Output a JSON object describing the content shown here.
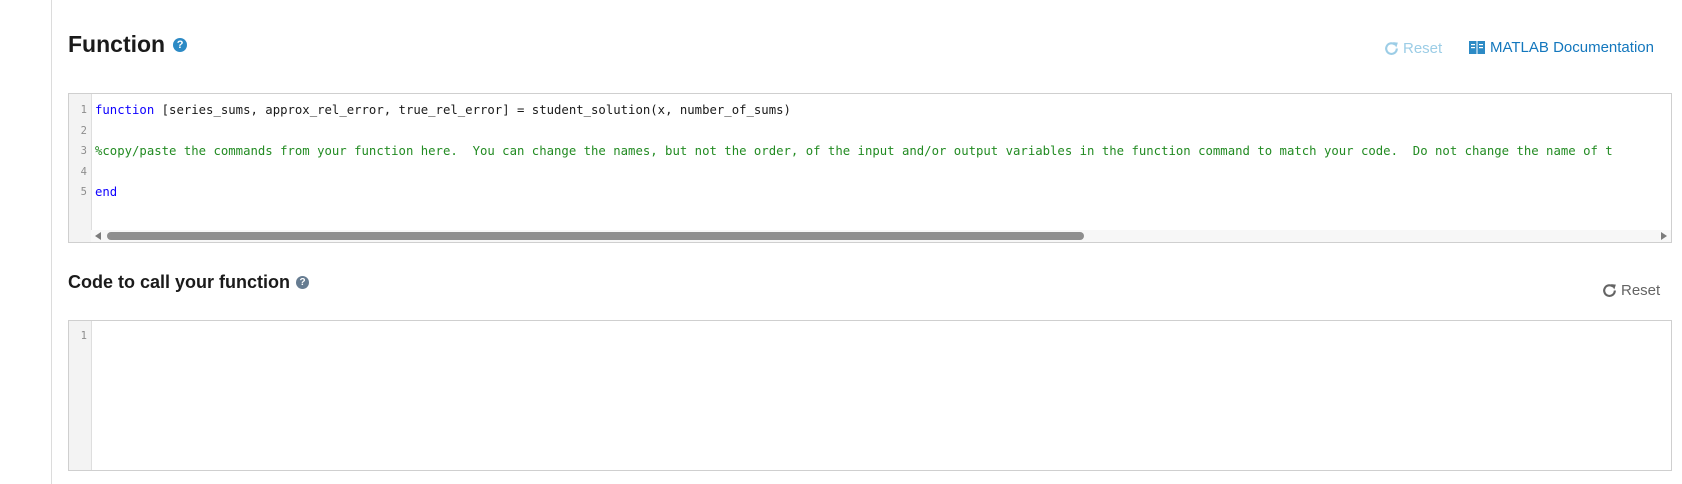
{
  "function_section": {
    "title": "Function",
    "help_icon": "question-circle-icon",
    "reset_label": "Reset",
    "reset_icon": "refresh-icon",
    "doc_label": "MATLAB Documentation",
    "doc_icon": "book-icon",
    "editor": {
      "lines": [
        {
          "num": "1",
          "parts": [
            {
              "type": "kw",
              "text": "function"
            },
            {
              "type": "plain",
              "text": " [series_sums, approx_rel_error, true_rel_error] = student_solution(x, number_of_sums)"
            }
          ]
        },
        {
          "num": "2",
          "parts": []
        },
        {
          "num": "3",
          "parts": [
            {
              "type": "cm",
              "text": "%copy/paste the commands from your function here.  You can change the names, but not the order, of the input and/or output variables in the function command to match your code.  Do not change the name of t"
            }
          ]
        },
        {
          "num": "4",
          "parts": []
        },
        {
          "num": "5",
          "parts": [
            {
              "type": "kw",
              "text": "end"
            }
          ]
        }
      ],
      "scrollbar": {
        "thumb_fraction": 0.63
      }
    }
  },
  "call_section": {
    "title": "Code to call your function",
    "help_icon": "question-circle-icon",
    "reset_label": "Reset",
    "reset_icon": "refresh-icon",
    "editor": {
      "lines": [
        {
          "num": "1",
          "parts": []
        }
      ]
    }
  },
  "colors": {
    "link_blue": "#1377bd",
    "reset_disabled": "#9ccde6",
    "reset_enabled": "#646464",
    "keyword": "#0e00ff",
    "comment": "#228b22"
  }
}
